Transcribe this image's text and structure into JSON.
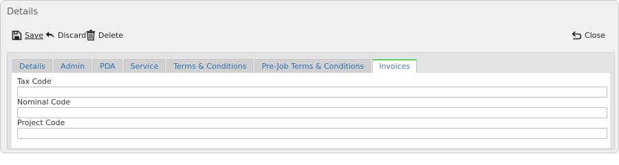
{
  "window": {
    "title": "Details"
  },
  "toolbar": {
    "save_label": "Save",
    "discard_label": "Discard",
    "delete_label": "Delete",
    "close_label": "Close"
  },
  "tabs": [
    {
      "label": "Details"
    },
    {
      "label": "Admin"
    },
    {
      "label": "PDA"
    },
    {
      "label": "Service"
    },
    {
      "label": "Terms & Conditions"
    },
    {
      "label": "Pre-Job Terms & Conditions"
    },
    {
      "label": "Invoices"
    }
  ],
  "active_tab": "Invoices",
  "fields": {
    "tax_code": {
      "label": "Tax Code",
      "value": ""
    },
    "nominal_code": {
      "label": "Nominal Code",
      "value": ""
    },
    "project_code": {
      "label": "Project Code",
      "value": ""
    }
  },
  "colors": {
    "tab_text": "#2c6fb6",
    "active_tab_accent": "#5cd65c"
  }
}
